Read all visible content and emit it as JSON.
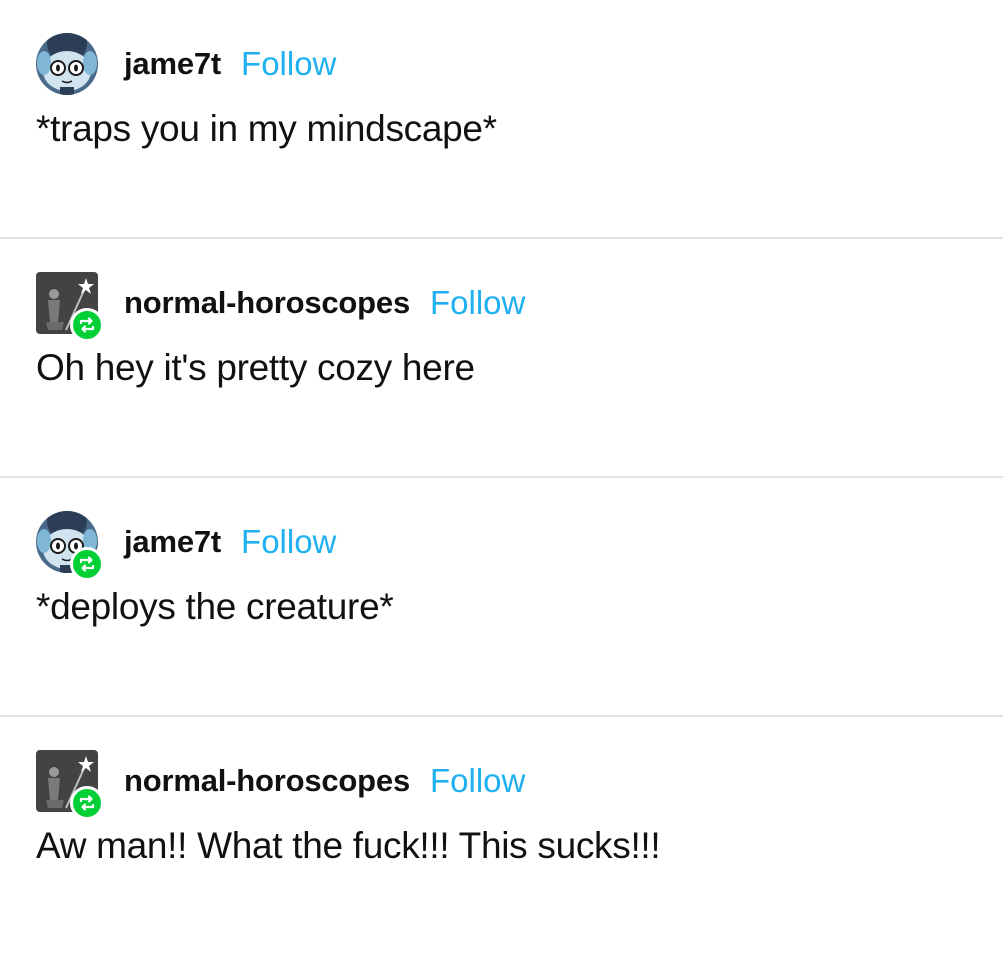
{
  "colors": {
    "follow": "#1eb0f0",
    "reblog_badge": "#00cf35",
    "divider": "#e2e2e2",
    "text": "#111111"
  },
  "posts": [
    {
      "username": "jame7t",
      "follow_label": "Follow",
      "avatar_icon": "ghost-creature-avatar",
      "reblogged": false,
      "text": "*traps you in my mindscape*"
    },
    {
      "username": "normal-horoscopes",
      "follow_label": "Follow",
      "avatar_icon": "wizard-figure-avatar",
      "reblogged": true,
      "text": "Oh hey it's pretty cozy here"
    },
    {
      "username": "jame7t",
      "follow_label": "Follow",
      "avatar_icon": "ghost-creature-avatar",
      "reblogged": true,
      "text": "*deploys the creature*"
    },
    {
      "username": "normal-horoscopes",
      "follow_label": "Follow",
      "avatar_icon": "wizard-figure-avatar",
      "reblogged": true,
      "text": "Aw man!! What the fuck!!! This sucks!!!"
    }
  ]
}
